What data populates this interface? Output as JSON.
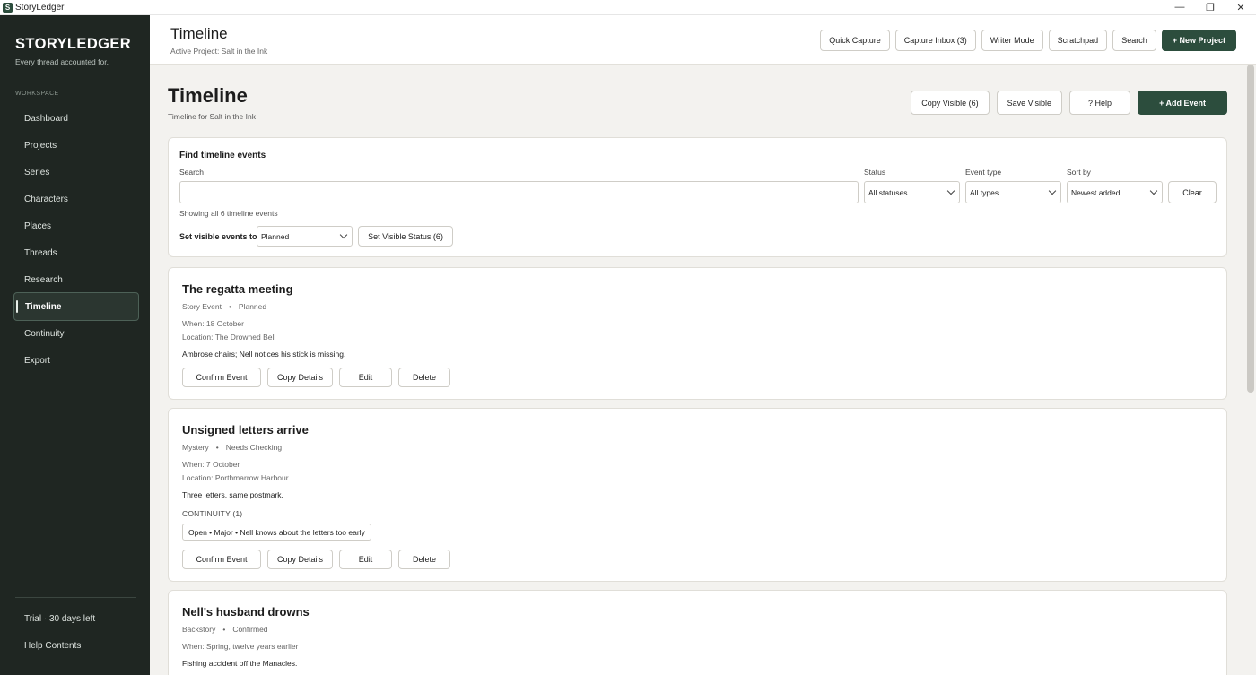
{
  "window": {
    "app_icon_letter": "S",
    "title": "StoryLedger",
    "minimize": "—",
    "maximize": "❐",
    "close": "✕"
  },
  "sidebar": {
    "brand": "STORYLEDGER",
    "tagline": "Every thread accounted for.",
    "section_label": "WORKSPACE",
    "items": [
      {
        "label": "Dashboard"
      },
      {
        "label": "Projects"
      },
      {
        "label": "Series"
      },
      {
        "label": "Characters"
      },
      {
        "label": "Places"
      },
      {
        "label": "Threads"
      },
      {
        "label": "Research"
      },
      {
        "label": "Timeline"
      },
      {
        "label": "Continuity"
      },
      {
        "label": "Export"
      }
    ],
    "active_item": "Timeline",
    "trial": "Trial · 30 days left",
    "help": "Help Contents"
  },
  "header": {
    "title": "Timeline",
    "subtitle": "Active Project: Salt in the Ink",
    "actions": {
      "quick_capture": "Quick Capture",
      "capture_inbox": "Capture Inbox (3)",
      "writer_mode": "Writer Mode",
      "scratchpad": "Scratchpad",
      "search": "Search",
      "new_project": "+ New Project"
    }
  },
  "page": {
    "title": "Timeline",
    "subtitle": "Timeline for Salt in the Ink",
    "actions": {
      "copy_visible": "Copy Visible (6)",
      "save_visible": "Save Visible",
      "help": "? Help",
      "add_event": "+ Add Event"
    }
  },
  "filters": {
    "heading": "Find timeline events",
    "search_label": "Search",
    "search_value": "",
    "status_label": "Status",
    "status_value": "All statuses",
    "type_label": "Event type",
    "type_value": "All types",
    "sort_label": "Sort by",
    "sort_value": "Newest added",
    "clear": "Clear",
    "showing": "Showing all 6 timeline events",
    "set_label": "Set visible events to",
    "set_value": "Planned",
    "set_button": "Set Visible Status (6)"
  },
  "events": [
    {
      "title": "The regatta meeting",
      "type": "Story Event",
      "status": "Planned",
      "when": "When: 18 October",
      "location": "Location: The Drowned Bell",
      "description": "Ambrose chairs; Nell notices his stick is missing.",
      "actions": {
        "confirm": "Confirm Event",
        "copy": "Copy Details",
        "edit": "Edit",
        "delete": "Delete"
      }
    },
    {
      "title": "Unsigned letters arrive",
      "type": "Mystery",
      "status": "Needs Checking",
      "when": "When: 7 October",
      "location": "Location: Porthmarrow Harbour",
      "description": "Three letters, same postmark.",
      "continuity_label": "CONTINUITY (1)",
      "continuity_item": "Open • Major • Nell knows about the letters too early",
      "actions": {
        "confirm": "Confirm Event",
        "copy": "Copy Details",
        "edit": "Edit",
        "delete": "Delete"
      }
    },
    {
      "title": "Nell's husband drowns",
      "type": "Backstory",
      "status": "Confirmed",
      "when": "When: Spring, twelve years earlier",
      "description": "Fishing accident off the Manacles."
    }
  ],
  "meta_separator": "•"
}
